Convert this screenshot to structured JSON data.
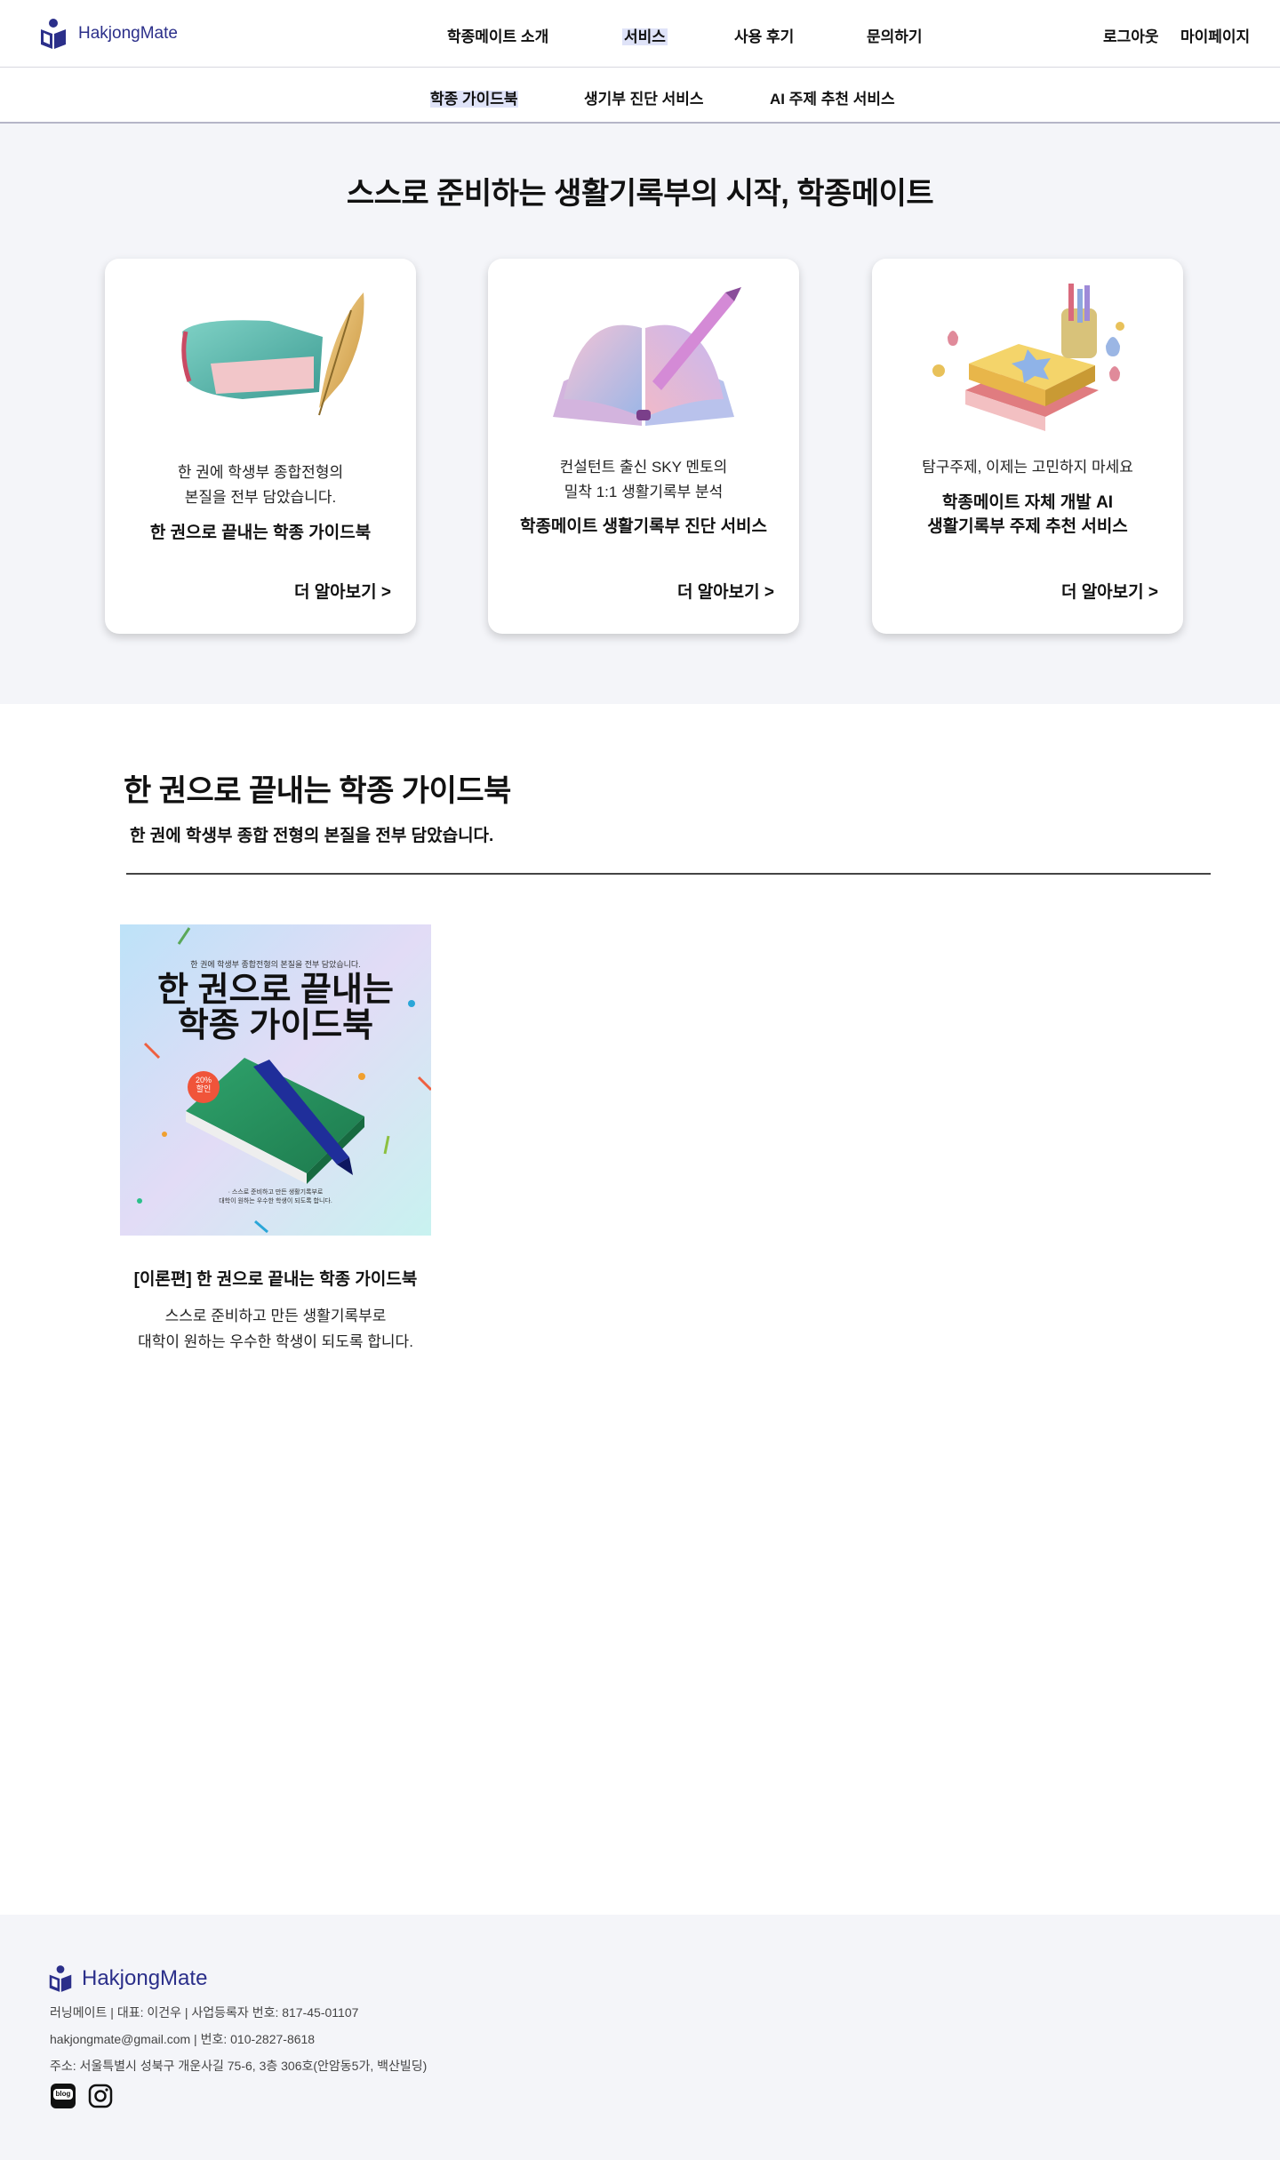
{
  "header": {
    "logo_text": "HakjongMate",
    "nav": [
      "학종메이트 소개",
      "서비스",
      "사용 후기",
      "문의하기"
    ],
    "right": [
      "로그아웃",
      "마이페이지"
    ]
  },
  "subnav": [
    "학종 가이드북",
    "생기부 진단 서비스",
    "AI 주제 추천 서비스"
  ],
  "hero": {
    "title": "스스로 준비하는 생활기록부의 시작, 학종메이트",
    "cards": [
      {
        "desc1": "한 권에 학생부 종합전형의",
        "desc2": "본질을 전부 담았습니다.",
        "title1": "한 권으로 끝내는 학종 가이드북",
        "title2": "",
        "more": "더 알아보기 >"
      },
      {
        "desc1": "컨설턴트 출신 SKY 멘토의",
        "desc2": "밀착 1:1 생활기록부 분석",
        "title1": "학종메이트 생활기록부 진단 서비스",
        "title2": "",
        "more": "더 알아보기 >"
      },
      {
        "desc1": "탐구주제, 이제는 고민하지 마세요",
        "desc2": "",
        "title1": "학종메이트 자체 개발 AI",
        "title2": "생활기록부 주제 추천 서비스",
        "more": "더 알아보기 >"
      }
    ]
  },
  "section": {
    "title": "한 권으로 끝내는 학종 가이드북",
    "subtitle": "한 권에 학생부 종합 전형의 본질을 전부 담았습니다."
  },
  "product": {
    "cover_top": "한 권에 학생부 종합전형의 본질을 전부 담았습니다.",
    "cover_title1": "한 권으로 끝내는",
    "cover_title2": "학종 가이드북",
    "badge1": "20%",
    "badge2": "할인",
    "cover_bottom1": "· 스스로 준비하고 만든 생활기록부로",
    "cover_bottom2": "대학이 원하는 우수한 학생이 되도록 합니다.",
    "title": "[이론편] 한 권으로 끝내는 학종 가이드북",
    "desc1": "스스로 준비하고 만든 생활기록부로",
    "desc2": "대학이 원하는 우수한 학생이 되도록 합니다."
  },
  "footer": {
    "logo_text": "HakjongMate",
    "line1": "러닝메이트 | 대표: 이건우 | 사업등록자 번호: 817-45-01107",
    "line2": "hakjongmate@gmail.com | 번호: 010-2827-8618",
    "line3": "주소: 서울특별시 성북구 개운사길 75-6, 3층 306호(안암동5가, 백산빌딩)",
    "icons": [
      "blog-icon",
      "instagram-icon"
    ],
    "blog_label": "blog"
  },
  "colors": {
    "brand": "#2b2f8a",
    "hero_bg": "#f4f5f9",
    "active_highlight": "#dfe3f8"
  }
}
